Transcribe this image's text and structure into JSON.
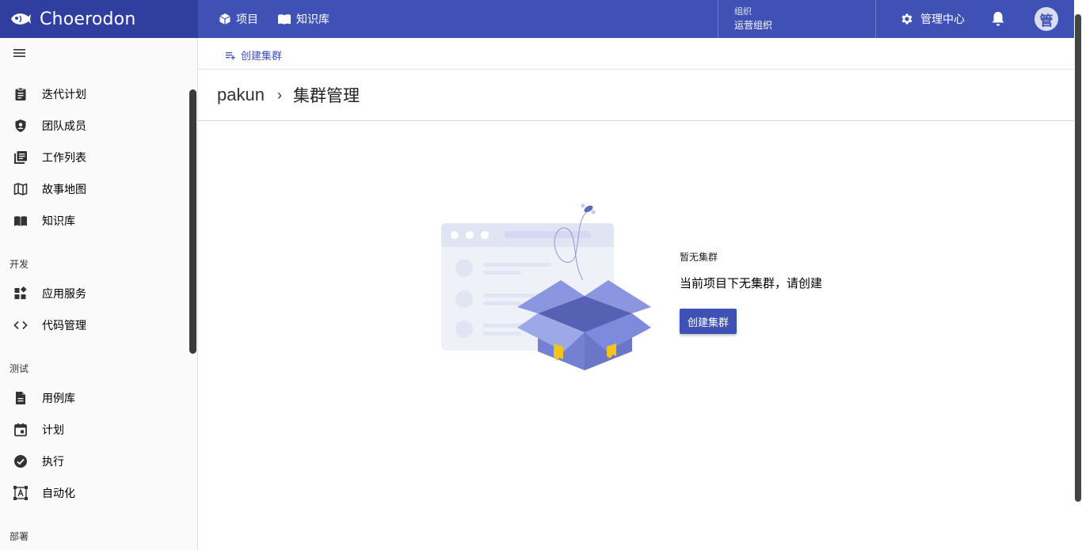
{
  "brand": {
    "name": "Choerodon"
  },
  "topnav": {
    "items": [
      {
        "label": "项目",
        "icon": "cube-icon"
      },
      {
        "label": "知识库",
        "icon": "book-icon"
      }
    ]
  },
  "org": {
    "label": "组织",
    "value": "运营组织"
  },
  "admin_center": {
    "label": "管理中心"
  },
  "avatar": {
    "text": "管"
  },
  "sidebar": {
    "items": [
      {
        "label": "迭代计划",
        "icon": "clipboard-icon"
      },
      {
        "label": "团队成员",
        "icon": "shield-user-icon"
      },
      {
        "label": "工作列表",
        "icon": "list-icon"
      },
      {
        "label": "故事地图",
        "icon": "map-icon"
      },
      {
        "label": "知识库",
        "icon": "book-icon"
      }
    ],
    "groups": [
      {
        "label": "开发",
        "items": [
          {
            "label": "应用服务",
            "icon": "widgets-icon"
          },
          {
            "label": "代码管理",
            "icon": "code-icon"
          }
        ]
      },
      {
        "label": "测试",
        "items": [
          {
            "label": "用例库",
            "icon": "document-icon"
          },
          {
            "label": "计划",
            "icon": "calendar-icon"
          },
          {
            "label": "执行",
            "icon": "check-circle-icon"
          },
          {
            "label": "自动化",
            "icon": "automation-icon"
          }
        ]
      },
      {
        "label": "部署"
      }
    ]
  },
  "toolbar": {
    "create_label": "创建集群"
  },
  "breadcrumb": {
    "project": "pakun",
    "separator": "›",
    "title": "集群管理"
  },
  "empty_state": {
    "title": "暂无集群",
    "description": "当前项目下无集群，请创建",
    "button": "创建集群"
  },
  "colors": {
    "primary": "#3F51B5",
    "primary_dark": "#303F9F"
  }
}
